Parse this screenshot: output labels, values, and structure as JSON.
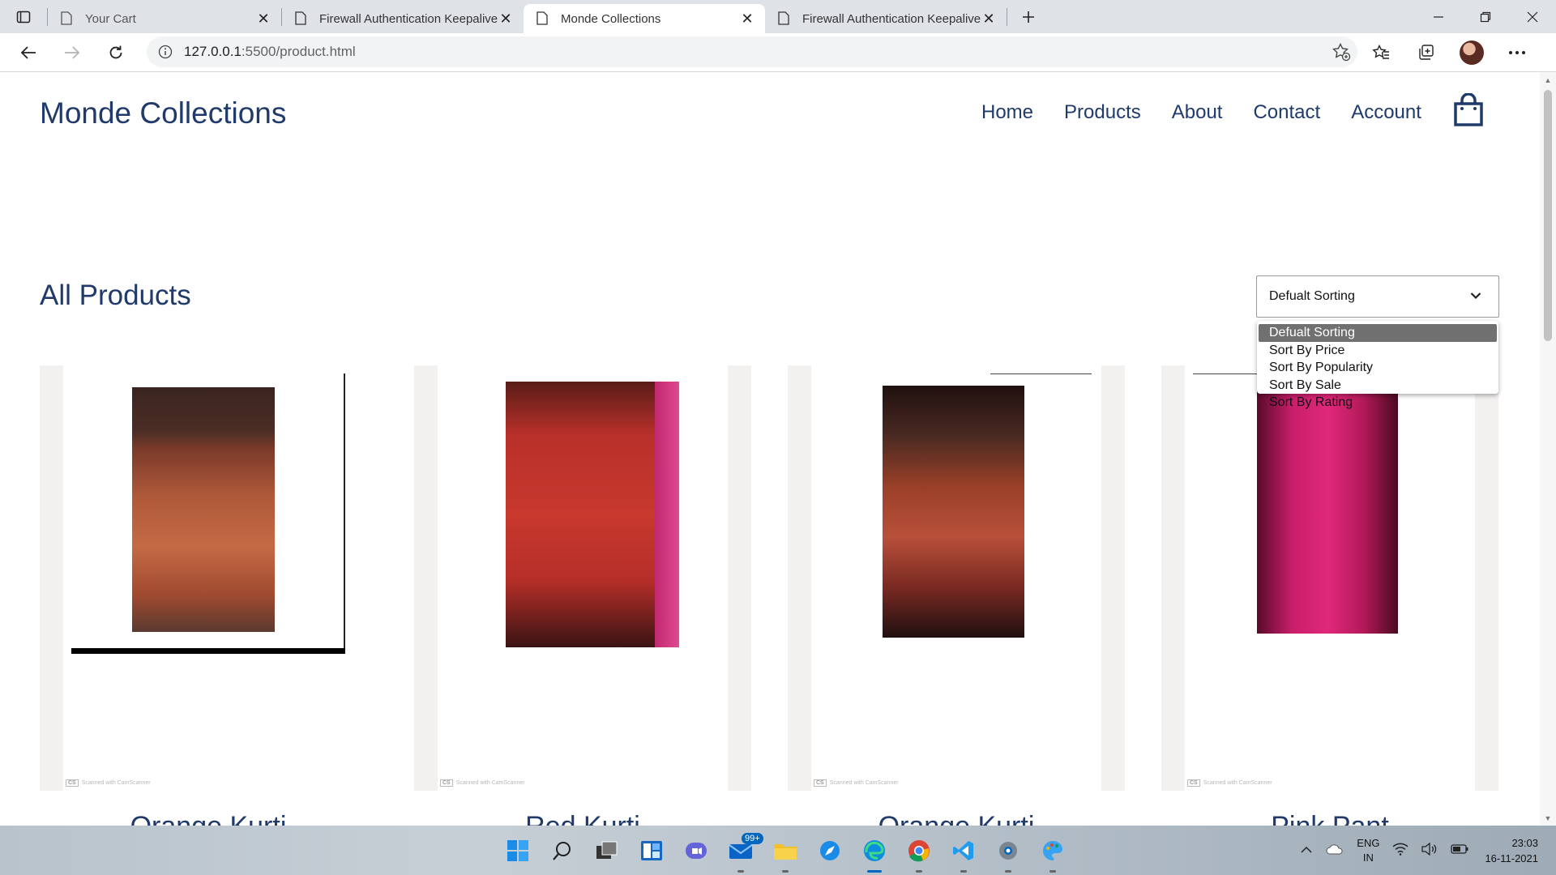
{
  "browser": {
    "tabs": [
      {
        "title": "Your Cart",
        "active": false
      },
      {
        "title": "Firewall Authentication Keepalive",
        "active": false
      },
      {
        "title": "Monde Collections",
        "active": true
      },
      {
        "title": "Firewall Authentication Keepalive",
        "active": false
      }
    ],
    "url_host": "127.0.0.1",
    "url_path": ":5500/product.html"
  },
  "site": {
    "logo": "Monde Collections",
    "nav": [
      "Home",
      "Products",
      "About",
      "Contact",
      "Account"
    ]
  },
  "products_section": {
    "title": "All Products",
    "sort": {
      "selected": "Defualt Sorting",
      "options": [
        "Defualt Sorting",
        "Sort By Price",
        "Sort By Popularity",
        "Sort By Sale",
        "Sort By Rating"
      ]
    },
    "cards": [
      {
        "name": "Orange Kurti"
      },
      {
        "name": "Red Kurti"
      },
      {
        "name": "Orange Kurti"
      },
      {
        "name": "Pink Pant"
      }
    ],
    "scan_watermark": "Scanned with CamScanner",
    "scan_logo": "CS"
  },
  "taskbar": {
    "mail_badge": "99+",
    "lang_top": "ENG",
    "lang_bottom": "IN",
    "time": "23:03",
    "date": "16-11-2021"
  },
  "colors": {
    "brand_text": "#1f3a6b",
    "selected_option": "#707070"
  }
}
